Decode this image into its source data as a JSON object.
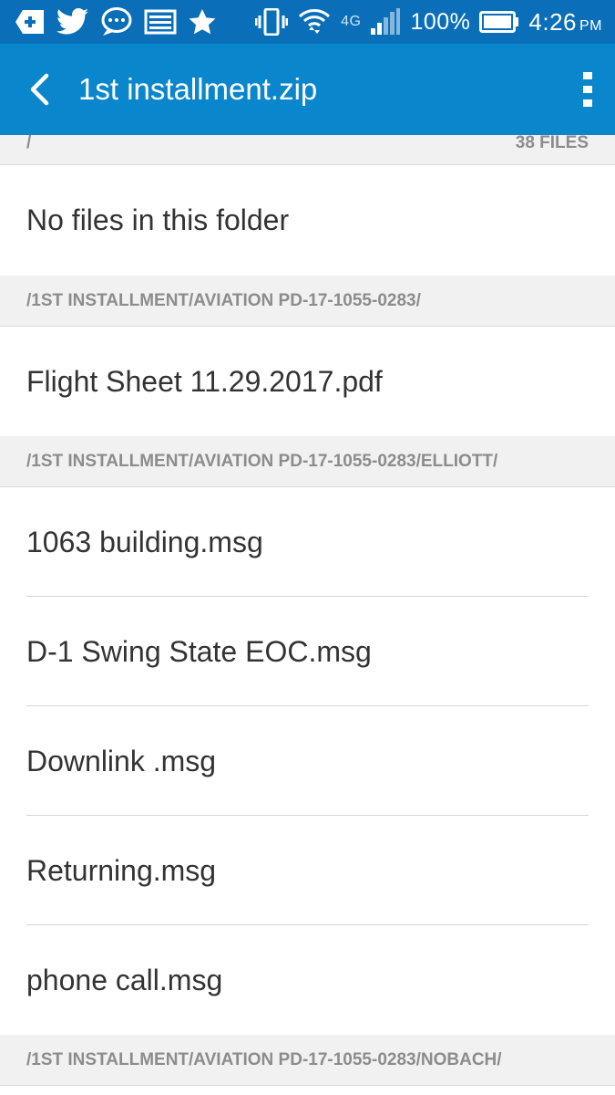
{
  "status_bar": {
    "battery_percent": "100%",
    "time": "4:26",
    "ampm": "PM",
    "network": "4G",
    "icons": [
      "add-icon",
      "twitter-icon",
      "chat-bubble-icon",
      "image-icon",
      "star-icon",
      "vibrate-icon",
      "wifi-icon",
      "lte-icon",
      "signal-icon",
      "battery-icon"
    ]
  },
  "app_bar": {
    "title": "1st installment.zip",
    "back_icon": "chevron-left-icon",
    "menu_icon": "more-vert-icon"
  },
  "root": {
    "path": "/",
    "file_count": "38 FILES"
  },
  "sections": [
    {
      "path": "/",
      "items": [],
      "empty_text": "No files in this folder"
    },
    {
      "path": "/1ST INSTALLMENT/AVIATION PD-17-1055-0283/",
      "items": [
        "Flight Sheet 11.29.2017.pdf"
      ]
    },
    {
      "path": "/1ST INSTALLMENT/AVIATION PD-17-1055-0283/ELLIOTT/",
      "items": [
        "1063 building.msg",
        "D-1 Swing State EOC.msg",
        "Downlink .msg",
        "Returning.msg",
        "phone call.msg"
      ]
    },
    {
      "path": "/1ST INSTALLMENT/AVIATION PD-17-1055-0283/NOBACH/",
      "items": []
    }
  ],
  "colors": {
    "status_bar": "#0a6fb8",
    "app_bar": "#0a86cc",
    "header_bg": "#f1f1f1",
    "header_text": "#8c8c8c",
    "item_text": "#333333"
  }
}
